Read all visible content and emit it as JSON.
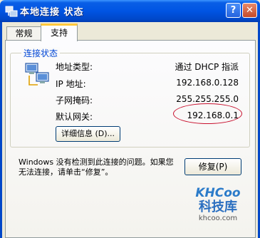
{
  "window": {
    "title": "本地连接  状态",
    "help_label": "?",
    "close_label": "✕"
  },
  "tabs": [
    {
      "label": "常规"
    },
    {
      "label": "支持"
    }
  ],
  "group": {
    "legend": "连接状态"
  },
  "rows": [
    {
      "label": "地址类型:",
      "value": "通过 DHCP 指派"
    },
    {
      "label": "IP 地址:",
      "value": "192.168.0.128"
    },
    {
      "label": "子网掩码:",
      "value": "255.255.255.0"
    },
    {
      "label": "默认网关:",
      "value": "192.168.0.1"
    }
  ],
  "buttons": {
    "details_label": "详细信息 (D)...",
    "repair_label": "修复(P)"
  },
  "message": "Windows 没有检测到此连接的问题。如果您无法连接，请单击“修复”。",
  "annotation": {
    "color": "#c8102e"
  },
  "watermark": {
    "logo": "KHCoo",
    "name": "科技库",
    "url": "khcoo.com"
  },
  "icons": {
    "title": "network-connection-icon",
    "status": "network-computers-icon"
  }
}
